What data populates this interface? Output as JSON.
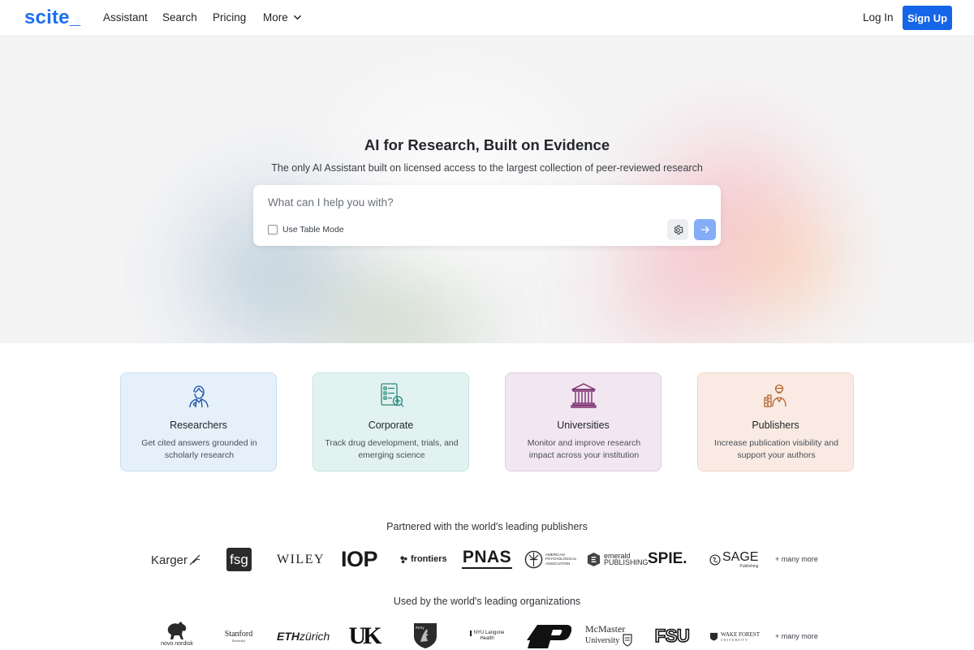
{
  "nav": {
    "logo": "scite_",
    "links": [
      "Assistant",
      "Search",
      "Pricing",
      "More"
    ],
    "login": "Log In",
    "signup": "Sign Up"
  },
  "hero": {
    "title": "AI for Research, Built on Evidence",
    "subtitle": "The only AI Assistant built on licensed access to the largest collection of peer-reviewed research",
    "search_placeholder": "What can I help you with?",
    "table_mode_label": "Use Table Mode",
    "table_mode_checked": false
  },
  "audiences": [
    {
      "title": "Researchers",
      "desc": "Get cited answers grounded in scholarly research",
      "icon": "researcher-icon"
    },
    {
      "title": "Corporate",
      "desc": "Track drug development, trials, and emerging science",
      "icon": "corporate-dashboard-icon"
    },
    {
      "title": "Universities",
      "desc": "Monitor and improve research impact across your institution",
      "icon": "university-building-icon"
    },
    {
      "title": "Publishers",
      "desc": "Increase publication visibility and support your authors",
      "icon": "publisher-icon"
    }
  ],
  "publishers": {
    "heading": "Partnered with the world's leading publishers",
    "logos": [
      "Karger",
      "fsg",
      "WILEY",
      "IOP",
      "frontiers",
      "PNAS",
      "AMERICAN PSYCHOLOGICAL ASSOCIATION",
      "emerald PUBLISHING",
      "SPIE.",
      "SAGE",
      "Publishing"
    ],
    "more": "+ many more"
  },
  "organizations": {
    "heading": "Used by the world's leading organizations",
    "logos": [
      "novo nordisk",
      "Stanford",
      "University",
      "ETH",
      "zürich",
      "UK",
      "Army",
      "NYU Langone",
      "Health",
      "P",
      "McMaster",
      "University",
      "FSU",
      "WAKE FOREST",
      "UNIVERSITY"
    ],
    "more": "+ many more"
  },
  "colors": {
    "brand_blue": "#1b6ff2",
    "signup_bg": "#1565e8",
    "go_button": "#85acf6"
  }
}
